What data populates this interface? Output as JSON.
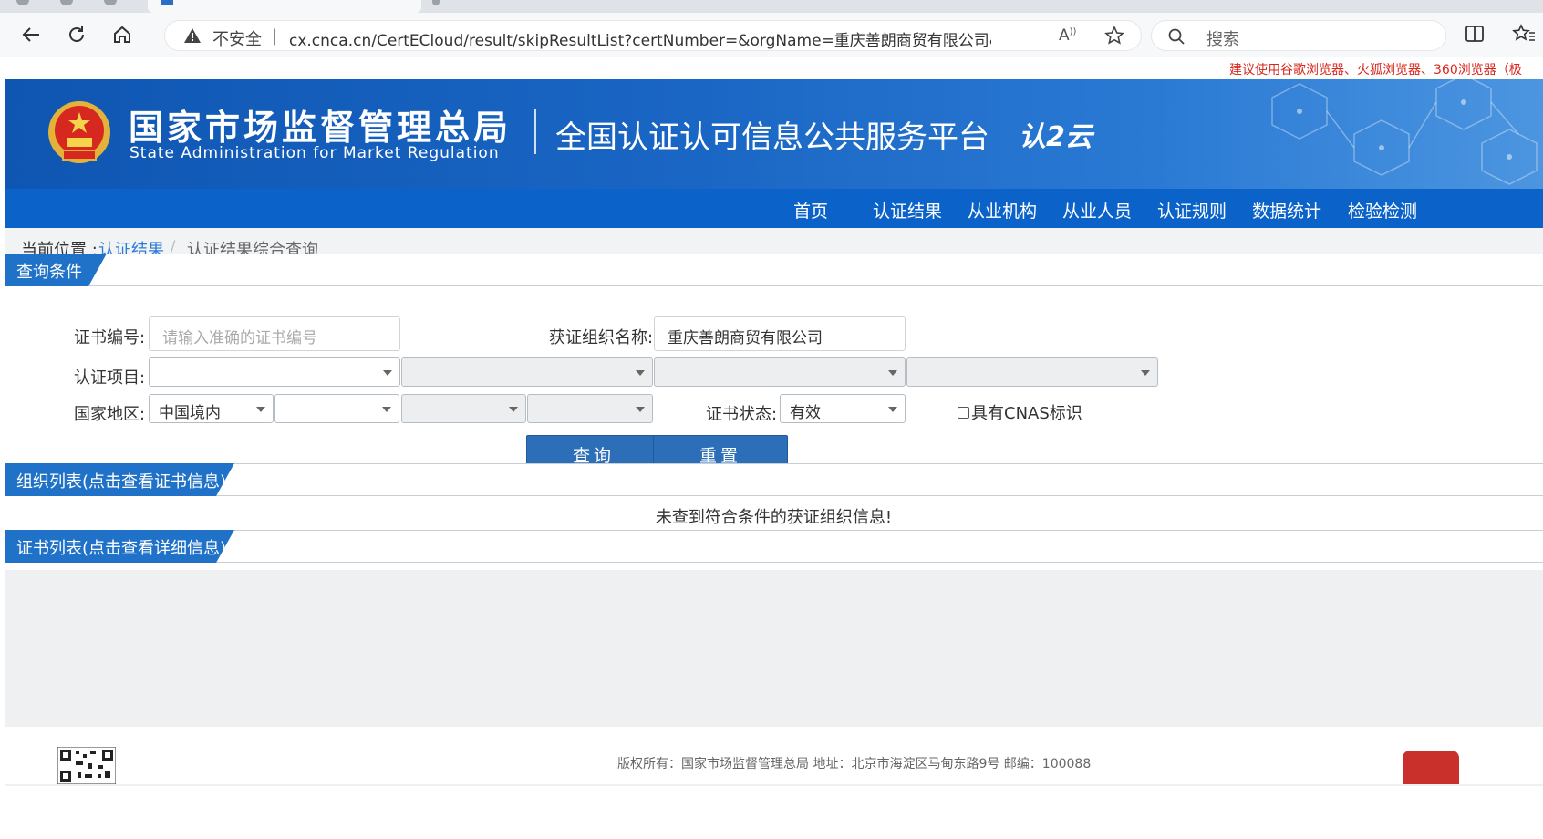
{
  "browser": {
    "security_label": "不安全",
    "url": "cx.cnca.cn/CertECloud/result/skipResultList?certNumber=&orgName=重庆善朗商贸有限公司&fromIndex...",
    "search_placeholder": "搜索"
  },
  "site": {
    "browser_notice": "建议使用谷歌浏览器、火狐浏览器、360浏览器（极",
    "org_name_cn": "国家市场监督管理总局",
    "org_name_en": "State Administration  for  Market Regulation",
    "platform_title": "全国认证认可信息公共服务平台",
    "logo_text": "认2云"
  },
  "nav": {
    "items": [
      "首页",
      "认证结果",
      "从业机构",
      "从业人员",
      "认证规则",
      "数据统计",
      "检验检测"
    ]
  },
  "breadcrumb": {
    "label": "当前位置 :",
    "link": "认证结果",
    "separator": "/",
    "current": "认证结果综合查询"
  },
  "query": {
    "section_title": "查询条件",
    "cert_number_label": "证书编号:",
    "cert_number_placeholder": "请输入准确的证书编号",
    "org_name_label": "获证组织名称:",
    "org_name_value": "重庆善朗商贸有限公司",
    "cert_item_label": "认证项目:",
    "region_label": "国家地区:",
    "region_value": "中国境内",
    "status_label": "证书状态:",
    "status_value": "有效",
    "cnas_label": "具有CNAS标识",
    "search_button": "查询",
    "reset_button": "重置"
  },
  "org_list": {
    "section_title": "组织列表(点击查看证书信息)",
    "empty_message": "未查到符合条件的获证组织信息!"
  },
  "cert_list": {
    "section_title": "证书列表(点击查看详细信息)"
  },
  "footer": {
    "text": "版权所有：国家市场监督管理总局    地址：北京市海淀区马甸东路9号    邮编：100088"
  }
}
